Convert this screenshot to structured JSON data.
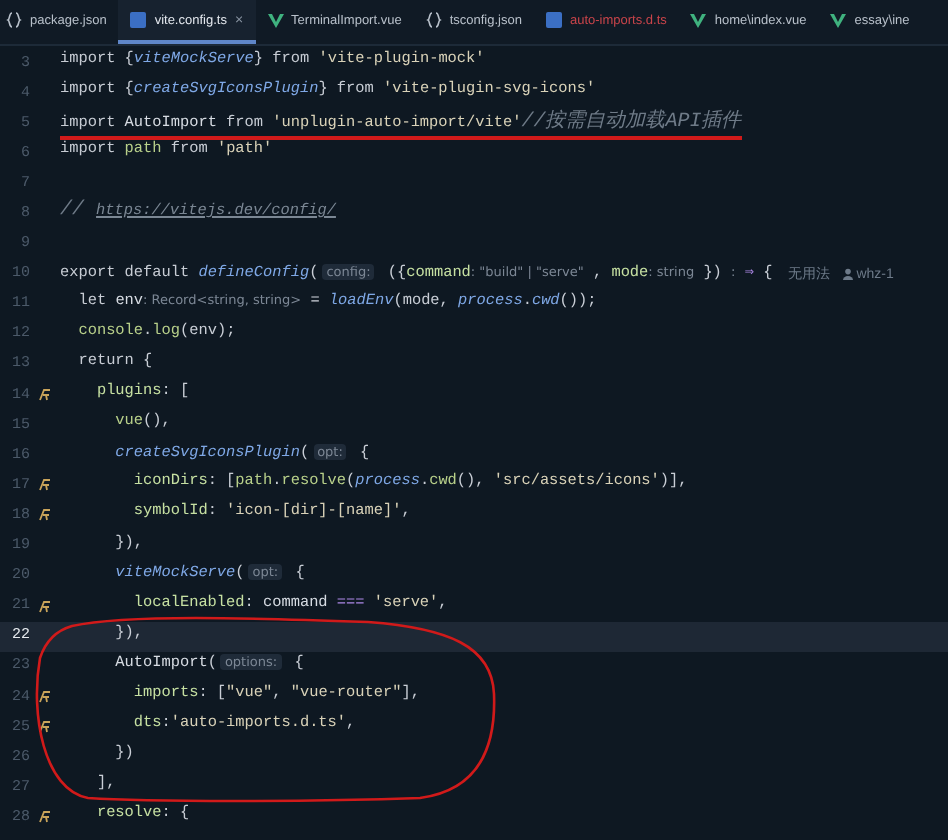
{
  "tabs": [
    {
      "label": "package.json",
      "kind": "json",
      "selected": false,
      "error": false
    },
    {
      "label": "vite.config.ts",
      "kind": "ts",
      "selected": true,
      "error": false,
      "close": "×"
    },
    {
      "label": "TerminalImport.vue",
      "kind": "vue",
      "selected": false,
      "error": false
    },
    {
      "label": "tsconfig.json",
      "kind": "json",
      "selected": false,
      "error": false
    },
    {
      "label": "auto-imports.d.ts",
      "kind": "ts",
      "selected": false,
      "error": true
    },
    {
      "label": "home\\index.vue",
      "kind": "vue",
      "selected": false,
      "error": false
    },
    {
      "label": "essay\\ine",
      "kind": "vue",
      "selected": false,
      "error": false
    }
  ],
  "lines": [
    {
      "number": "3",
      "marker": false,
      "current": false,
      "underlined": false,
      "code": [
        {
          "kind": "kw",
          "text": "import "
        },
        {
          "kind": "p",
          "text": "{"
        },
        {
          "kind": "fn",
          "text": "viteMockServe"
        },
        {
          "kind": "p",
          "text": "} "
        },
        {
          "kind": "kw",
          "text": "from "
        },
        {
          "kind": "s",
          "text": "'vite-plugin-mock'"
        }
      ]
    },
    {
      "number": "4",
      "marker": false,
      "current": false,
      "underlined": false,
      "code": [
        {
          "kind": "kw",
          "text": "import "
        },
        {
          "kind": "p",
          "text": "{"
        },
        {
          "kind": "fn",
          "text": "createSvgIconsPlugin"
        },
        {
          "kind": "p",
          "text": "} "
        },
        {
          "kind": "kw",
          "text": "from "
        },
        {
          "kind": "s",
          "text": "'vite-plugin-svg-icons'"
        }
      ]
    },
    {
      "number": "5",
      "marker": false,
      "current": false,
      "underlined": true,
      "code": [
        {
          "kind": "kw",
          "text": "import "
        },
        {
          "kind": "id",
          "text": "AutoImport "
        },
        {
          "kind": "kw",
          "text": "from "
        },
        {
          "kind": "s",
          "text": "'unplugin-auto-import/vite'"
        },
        {
          "kind": "cm",
          "text": "//按需自动加载API插件"
        }
      ]
    },
    {
      "number": "6",
      "marker": false,
      "current": false,
      "underlined": false,
      "code": [
        {
          "kind": "kw",
          "text": "import "
        },
        {
          "kind": "g",
          "text": "path "
        },
        {
          "kind": "kw",
          "text": "from "
        },
        {
          "kind": "s",
          "text": "'path'"
        }
      ]
    },
    {
      "number": "7",
      "marker": false,
      "current": false
    },
    {
      "number": "8",
      "marker": false,
      "current": false,
      "underlined": false,
      "code": [
        {
          "kind": "cm",
          "text": "// "
        },
        {
          "kind": "link",
          "text": "https://vitejs.dev/config/"
        }
      ]
    },
    {
      "number": "9",
      "marker": false,
      "current": false
    },
    {
      "number": "10",
      "marker": false,
      "current": false,
      "underlined": false,
      "code": [
        {
          "kind": "kw",
          "text": "export default "
        },
        {
          "kind": "fn",
          "text": "defineConfig"
        },
        {
          "kind": "p",
          "text": "("
        },
        {
          "kind": "box",
          "text": "config:"
        },
        {
          "kind": "p",
          "text": " ({"
        },
        {
          "kind": "prop",
          "text": "command"
        },
        {
          "kind": "hint",
          "text": ": \"build\" | \"serve\""
        },
        {
          "kind": "p",
          "text": " , "
        },
        {
          "kind": "prop",
          "text": "mode"
        },
        {
          "kind": "hint",
          "text": ": string"
        },
        {
          "kind": "p",
          "text": " }) "
        },
        {
          "kind": "hint",
          "text": ":"
        },
        {
          "kind": "op",
          "text": " ⇒ "
        },
        {
          "kind": "p",
          "text": "{"
        }
      ],
      "lens": "无用法",
      "author": "whz-1"
    },
    {
      "number": "11",
      "marker": false,
      "current": false,
      "underlined": false,
      "code": [
        {
          "kind": "kw",
          "text": "  let "
        },
        {
          "kind": "id",
          "text": "env"
        },
        {
          "kind": "hint",
          "text": ": Record<string, string>"
        },
        {
          "kind": "p",
          "text": " = "
        },
        {
          "kind": "fn",
          "text": "loadEnv"
        },
        {
          "kind": "p",
          "text": "(mode, "
        },
        {
          "kind": "fn",
          "text": "process"
        },
        {
          "kind": "p",
          "text": "."
        },
        {
          "kind": "fn",
          "text": "cwd"
        },
        {
          "kind": "p",
          "text": "());"
        }
      ]
    },
    {
      "number": "12",
      "marker": false,
      "current": false,
      "underlined": false,
      "code": [
        {
          "kind": "g",
          "text": "  console"
        },
        {
          "kind": "p",
          "text": "."
        },
        {
          "kind": "g",
          "text": "log"
        },
        {
          "kind": "p",
          "text": "(env);"
        }
      ]
    },
    {
      "number": "13",
      "marker": false,
      "current": false,
      "underlined": false,
      "code": [
        {
          "kind": "kw",
          "text": "  return "
        },
        {
          "kind": "p",
          "text": "{"
        }
      ]
    },
    {
      "number": "14",
      "marker": true,
      "current": false,
      "underlined": false,
      "code": [
        {
          "kind": "prop",
          "text": "    plugins"
        },
        {
          "kind": "p",
          "text": ": ["
        }
      ]
    },
    {
      "number": "15",
      "marker": false,
      "current": false,
      "underlined": false,
      "code": [
        {
          "kind": "g",
          "text": "      vue"
        },
        {
          "kind": "p",
          "text": "(),"
        }
      ]
    },
    {
      "number": "16",
      "marker": false,
      "current": false,
      "underlined": false,
      "code": [
        {
          "kind": "fn",
          "text": "      createSvgIconsPlugin"
        },
        {
          "kind": "p",
          "text": "("
        },
        {
          "kind": "box",
          "text": "opt:"
        },
        {
          "kind": "p",
          "text": " {"
        }
      ]
    },
    {
      "number": "17",
      "marker": true,
      "current": false,
      "underlined": false,
      "code": [
        {
          "kind": "prop",
          "text": "        iconDirs"
        },
        {
          "kind": "p",
          "text": ": ["
        },
        {
          "kind": "g",
          "text": "path"
        },
        {
          "kind": "p",
          "text": "."
        },
        {
          "kind": "g",
          "text": "resolve"
        },
        {
          "kind": "p",
          "text": "("
        },
        {
          "kind": "fn",
          "text": "process"
        },
        {
          "kind": "p",
          "text": "."
        },
        {
          "kind": "g",
          "text": "cwd"
        },
        {
          "kind": "p",
          "text": "(), "
        },
        {
          "kind": "s",
          "text": "'src/assets/icons'"
        },
        {
          "kind": "p",
          "text": ")],"
        }
      ]
    },
    {
      "number": "18",
      "marker": true,
      "current": false,
      "underlined": false,
      "code": [
        {
          "kind": "prop",
          "text": "        symbolId"
        },
        {
          "kind": "p",
          "text": ": "
        },
        {
          "kind": "s",
          "text": "'icon-[dir]-[name]'"
        },
        {
          "kind": "p",
          "text": ","
        }
      ]
    },
    {
      "number": "19",
      "marker": false,
      "current": false,
      "underlined": false,
      "code": [
        {
          "kind": "p",
          "text": "      }),"
        }
      ]
    },
    {
      "number": "20",
      "marker": false,
      "current": false,
      "underlined": false,
      "code": [
        {
          "kind": "fn",
          "text": "      viteMockServe"
        },
        {
          "kind": "p",
          "text": "("
        },
        {
          "kind": "box",
          "text": "opt:"
        },
        {
          "kind": "p",
          "text": " {"
        }
      ]
    },
    {
      "number": "21",
      "marker": true,
      "current": false,
      "underlined": false,
      "code": [
        {
          "kind": "prop",
          "text": "        localEnabled"
        },
        {
          "kind": "p",
          "text": ": "
        },
        {
          "kind": "id",
          "text": "command "
        },
        {
          "kind": "op",
          "text": "==="
        },
        {
          "kind": "s",
          "text": " 'serve'"
        },
        {
          "kind": "p",
          "text": ","
        }
      ]
    },
    {
      "number": "22",
      "marker": false,
      "current": true,
      "underlined": false,
      "code": [
        {
          "kind": "p",
          "text": "      }),"
        }
      ]
    },
    {
      "number": "23",
      "marker": false,
      "current": false,
      "underlined": false,
      "code": [
        {
          "kind": "id",
          "text": "      AutoImport"
        },
        {
          "kind": "p",
          "text": "("
        },
        {
          "kind": "box",
          "text": "options:"
        },
        {
          "kind": "p",
          "text": " {"
        }
      ]
    },
    {
      "number": "24",
      "marker": true,
      "current": false,
      "underlined": false,
      "code": [
        {
          "kind": "prop",
          "text": "        imports"
        },
        {
          "kind": "p",
          "text": ": ["
        },
        {
          "kind": "s",
          "text": "\"vue\""
        },
        {
          "kind": "p",
          "text": ", "
        },
        {
          "kind": "s",
          "text": "\"vue-router\""
        },
        {
          "kind": "p",
          "text": "],"
        }
      ]
    },
    {
      "number": "25",
      "marker": true,
      "current": false,
      "underlined": false,
      "code": [
        {
          "kind": "prop",
          "text": "        dts"
        },
        {
          "kind": "p",
          "text": ":"
        },
        {
          "kind": "s",
          "text": "'auto-imports.d.ts'"
        },
        {
          "kind": "p",
          "text": ","
        }
      ]
    },
    {
      "number": "26",
      "marker": false,
      "current": false,
      "underlined": false,
      "code": [
        {
          "kind": "p",
          "text": "      })"
        }
      ]
    },
    {
      "number": "27",
      "marker": false,
      "current": false,
      "underlined": false,
      "code": [
        {
          "kind": "p",
          "text": "    ],"
        }
      ]
    },
    {
      "number": "28",
      "marker": true,
      "current": false,
      "underlined": false,
      "code": [
        {
          "kind": "prop",
          "text": "    resolve"
        },
        {
          "kind": "p",
          "text": ": {"
        }
      ]
    }
  ],
  "ellipse_annotation": true
}
